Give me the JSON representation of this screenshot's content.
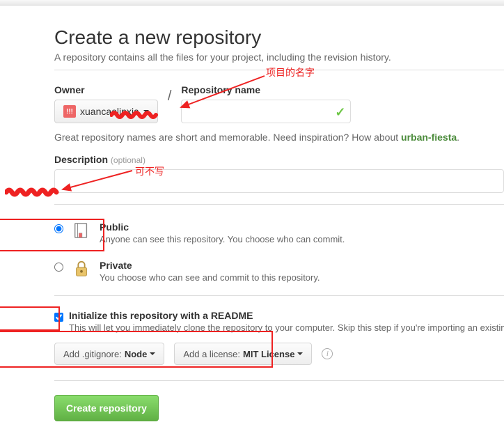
{
  "header": {
    "title": "Create a new repository",
    "subtitle": "A repository contains all the files for your project, including the revision history."
  },
  "owner": {
    "label": "Owner",
    "username": "xuancaolinxia"
  },
  "repo": {
    "label": "Repository name",
    "value": ""
  },
  "hint": {
    "text_before": "Great repository names are short and memorable. Need inspiration? How about ",
    "suggestion": "urban-fiesta",
    "after": "."
  },
  "description": {
    "label": "Description",
    "optional": "(optional)",
    "value": ""
  },
  "visibility": {
    "public": {
      "title": "Public",
      "desc": "Anyone can see this repository. You choose who can commit."
    },
    "private": {
      "title": "Private",
      "desc": "You choose who can see and commit to this repository."
    }
  },
  "init": {
    "title": "Initialize this repository with a README",
    "desc": "This will let you immediately clone the repository to your computer. Skip this step if you're importing an existing repository."
  },
  "dropdowns": {
    "gitignore_prefix": "Add .gitignore: ",
    "gitignore_value": "Node",
    "license_prefix": "Add a license: ",
    "license_value": "MIT License"
  },
  "submit": {
    "label": "Create repository"
  },
  "annotations": {
    "name": "项目的名字",
    "desc": "可不写"
  }
}
